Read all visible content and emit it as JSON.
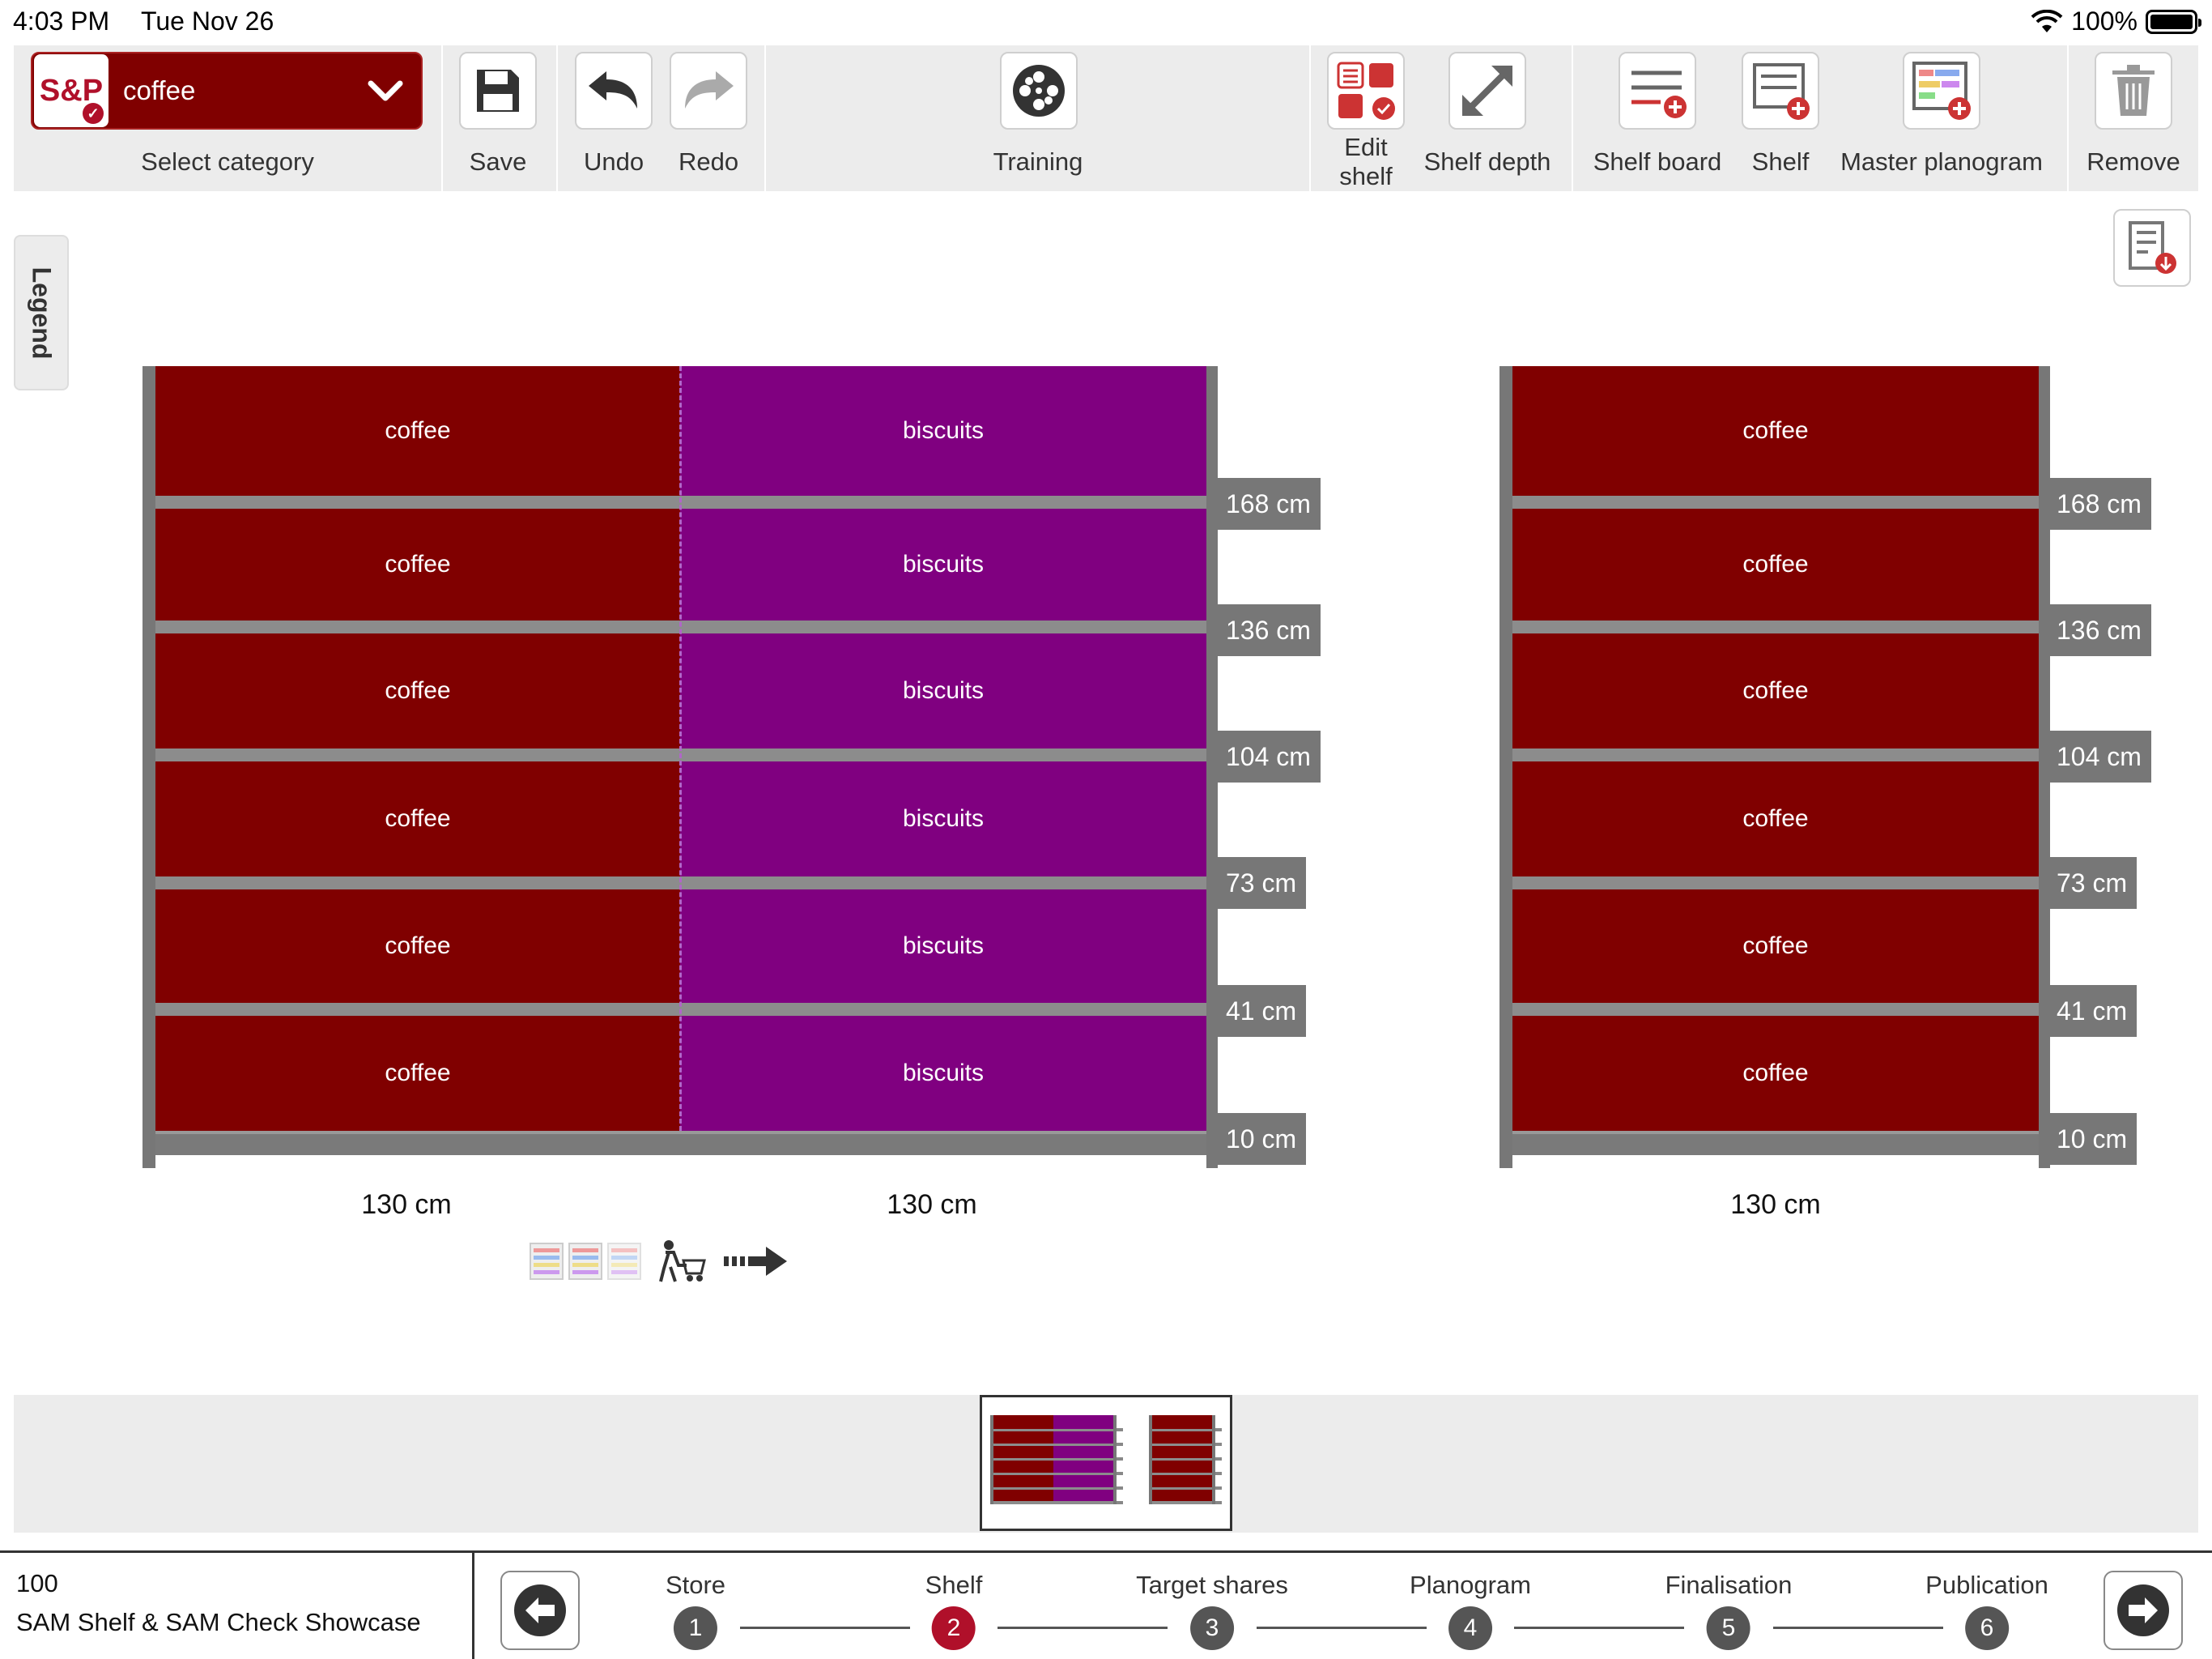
{
  "status": {
    "time": "4:03 PM",
    "date": "Tue Nov 26",
    "battery": "100%"
  },
  "toolbar": {
    "category_logo": "S&P",
    "category_value": "coffee",
    "select_category": "Select category",
    "save": "Save",
    "undo": "Undo",
    "redo": "Redo",
    "training": "Training",
    "edit_shelf_1": "Edit",
    "edit_shelf_2": "shelf",
    "shelf_depth": "Shelf depth",
    "shelf_board": "Shelf board",
    "shelf": "Shelf",
    "master_planogram": "Master planogram",
    "remove": "Remove"
  },
  "legend": "Legend",
  "unit_left": {
    "rows": [
      {
        "left": "coffee",
        "right": "biscuits",
        "height": "168 cm"
      },
      {
        "left": "coffee",
        "right": "biscuits",
        "height": "136 cm"
      },
      {
        "left": "coffee",
        "right": "biscuits",
        "height": "104 cm"
      },
      {
        "left": "coffee",
        "right": "biscuits",
        "height": "73 cm"
      },
      {
        "left": "coffee",
        "right": "biscuits",
        "height": "41 cm"
      },
      {
        "left": "coffee",
        "right": "biscuits",
        "height": "10 cm"
      }
    ],
    "widths": [
      "130 cm",
      "130 cm"
    ]
  },
  "unit_right": {
    "rows": [
      {
        "cell": "coffee",
        "height": "168 cm"
      },
      {
        "cell": "coffee",
        "height": "136 cm"
      },
      {
        "cell": "coffee",
        "height": "104 cm"
      },
      {
        "cell": "coffee",
        "height": "73 cm"
      },
      {
        "cell": "coffee",
        "height": "41 cm"
      },
      {
        "cell": "coffee",
        "height": "10 cm"
      }
    ],
    "width": "130 cm"
  },
  "store": {
    "number": "100",
    "name": "SAM Shelf & SAM Check Showcase"
  },
  "steps": [
    {
      "label": "Store",
      "num": "1"
    },
    {
      "label": "Shelf",
      "num": "2"
    },
    {
      "label": "Target shares",
      "num": "3"
    },
    {
      "label": "Planogram",
      "num": "4"
    },
    {
      "label": "Finalisation",
      "num": "5"
    },
    {
      "label": "Publication",
      "num": "6"
    }
  ],
  "colors": {
    "coffee": "#800000",
    "biscuits": "#800080",
    "accent": "#b0102a"
  }
}
